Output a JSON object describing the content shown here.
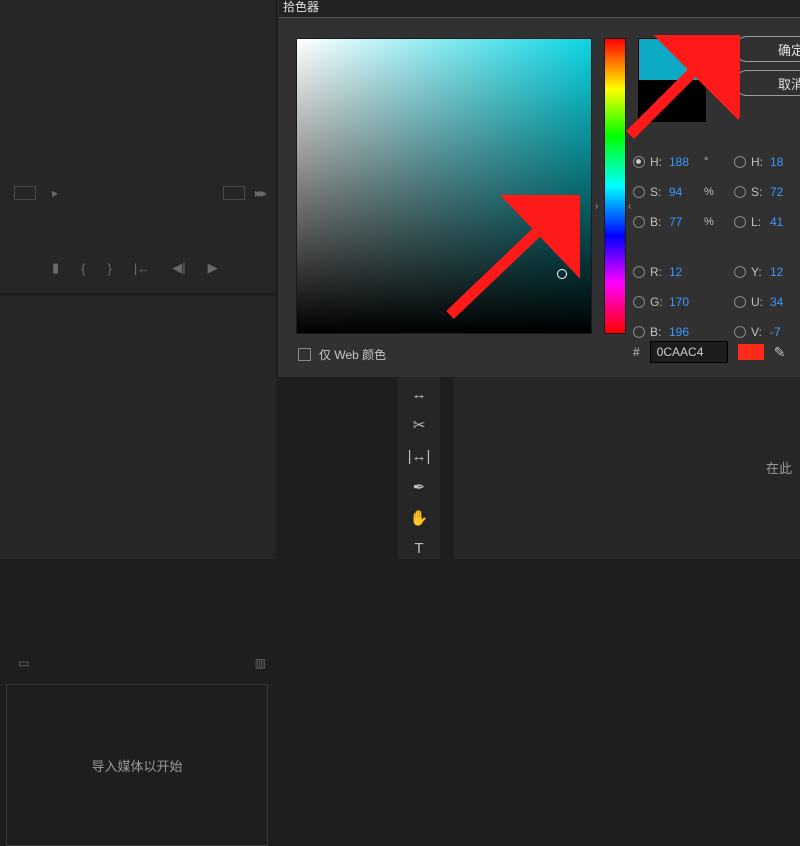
{
  "dialog": {
    "title": "拾色器",
    "ok": "确定",
    "cancel": "取消",
    "web_only": "仅 Web 颜色",
    "hex_label": "#",
    "hex": "0CAAC4",
    "preview_new": "#0CAAC4",
    "preview_old": "#000000",
    "labels": {
      "H": "H:",
      "S": "S:",
      "B": "B:",
      "R": "R:",
      "G": "G:",
      "B2": "B:",
      "L": "L:",
      "Y": "Y:",
      "U": "U:",
      "V": "V:"
    },
    "hsb": {
      "h": "188",
      "s": "94",
      "b": "77"
    },
    "rgb": {
      "r": "12",
      "g": "170",
      "b": "196"
    },
    "hsl": {
      "h": "18",
      "s": "72",
      "l": "41"
    },
    "yuv": {
      "y": "12",
      "u": "34",
      "v": "-7"
    },
    "deg": "°",
    "pct": "%"
  },
  "left": {
    "import": "导入媒体以开始"
  },
  "right": {
    "here": "在此"
  }
}
